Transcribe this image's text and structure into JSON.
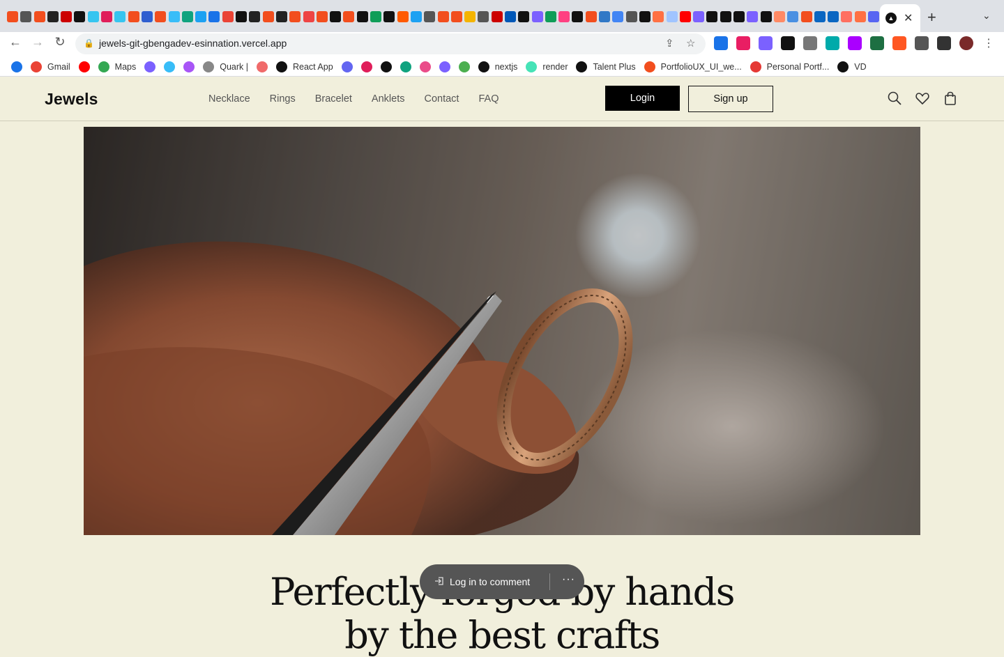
{
  "browser": {
    "address": "jewels-git-gbengadev-esinnation.vercel.app",
    "active_tab_icon": "nextjs-icon",
    "tab_favicon_colors": [
      "#f24e1e",
      "#555",
      "#f24e1e",
      "#222",
      "#c00",
      "#111",
      "#36c5f0",
      "#e01e5a",
      "#36c5f0",
      "#f24e1e",
      "#2f5fd0",
      "#f24e1e",
      "#38bdf8",
      "#10a37f",
      "#1da1f2",
      "#1a73e8",
      "#ea4335",
      "#111",
      "#222",
      "#f24e1e",
      "#222",
      "#f24e1e",
      "#e44",
      "#f24e1e",
      "#111",
      "#f24e1e",
      "#111",
      "#0f9d58",
      "#111",
      "#ff5a00",
      "#1da1f2",
      "#555",
      "#f24e1e",
      "#f24e1e",
      "#f4b400",
      "#555",
      "#c00",
      "#0057b7",
      "#111",
      "#7b61ff",
      "#0f9d58",
      "#ff4081",
      "#111",
      "#f24e1e",
      "#3178c6",
      "#4285f4",
      "#555",
      "#111",
      "#ff7043",
      "#a0c4ff",
      "#ff0000",
      "#7b61ff",
      "#111",
      "#111",
      "#111",
      "#7b61ff",
      "#111",
      "#ff8a65",
      "#4a90e2",
      "#f24e1e",
      "#0a66c2",
      "#0a66c2",
      "#ff6f61",
      "#ff7043",
      "#5865f2",
      "#e66"
    ],
    "ext_icon_colors": [
      "#1a73e8",
      "#e91e63",
      "#7b61ff",
      "#111",
      "#777",
      "#0aa",
      "#a0f",
      "#1d6f42",
      "#ff5722",
      "#555",
      "#333"
    ]
  },
  "bookmarks": [
    {
      "label": "",
      "icon": "chrome-ext-icon",
      "color": "#1a73e8"
    },
    {
      "label": "Gmail",
      "icon": "gmail-icon",
      "color": "#ea4335"
    },
    {
      "label": "",
      "icon": "youtube-icon",
      "color": "#ff0000"
    },
    {
      "label": "Maps",
      "icon": "maps-icon",
      "color": "#34a853"
    },
    {
      "label": "",
      "icon": "canva-icon",
      "color": "#7b61ff"
    },
    {
      "label": "",
      "icon": "tailwind-icon",
      "color": "#38bdf8"
    },
    {
      "label": "",
      "icon": "bookmark-icon",
      "color": "#a855f7"
    },
    {
      "label": "Quark |",
      "icon": "quark-icon",
      "color": "#888"
    },
    {
      "label": "",
      "icon": "asana-icon",
      "color": "#f06a6a"
    },
    {
      "label": "React App",
      "icon": "react-app-icon",
      "color": "#111"
    },
    {
      "label": "",
      "icon": "stitches-icon",
      "color": "#6366f1"
    },
    {
      "label": "",
      "icon": "slack-icon",
      "color": "#e01e5a"
    },
    {
      "label": "",
      "icon": "typeform-icon",
      "color": "#111"
    },
    {
      "label": "",
      "icon": "chatgpt-icon",
      "color": "#10a37f"
    },
    {
      "label": "",
      "icon": "dribbble-icon",
      "color": "#ea4c89"
    },
    {
      "label": "",
      "icon": "arrow-icon",
      "color": "#7b61ff"
    },
    {
      "label": "",
      "icon": "rainbow-icon",
      "color": "#4caf50"
    },
    {
      "label": "nextjs",
      "icon": "nextjs-icon",
      "color": "#111"
    },
    {
      "label": "render",
      "icon": "render-icon",
      "color": "#46e3b7"
    },
    {
      "label": "Talent Plus",
      "icon": "talent-plus-icon",
      "color": "#111"
    },
    {
      "label": "PortfolioUX_UI_we...",
      "icon": "figma-icon",
      "color": "#f24e1e"
    },
    {
      "label": "Personal Portf...",
      "icon": "palette-icon",
      "color": "#e53935"
    },
    {
      "label": "VD",
      "icon": "vercel-icon",
      "color": "#111"
    }
  ],
  "site": {
    "logo": "Jewels",
    "nav": [
      "Necklace",
      "Rings",
      "Bracelet",
      "Anklets",
      "Contact",
      "FAQ"
    ],
    "login": "Login",
    "signup": "Sign up",
    "headline_1": "Perfectly forged by hands",
    "headline_2": "by the best crafts"
  },
  "comment_bar": {
    "label": "Log in to comment",
    "more": "···"
  }
}
